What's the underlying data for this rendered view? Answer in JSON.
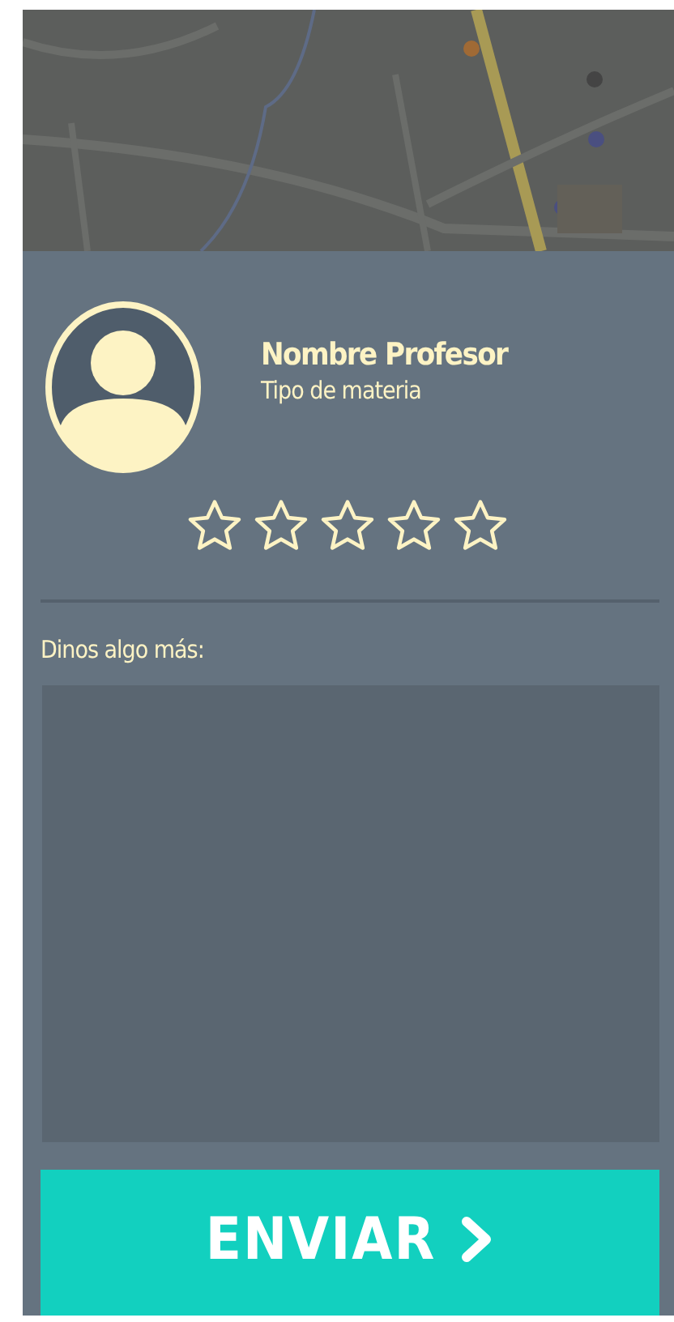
{
  "profile": {
    "name": "Nombre Profesor",
    "subject": "Tipo de materia"
  },
  "rating": {
    "stars": 0
  },
  "comment": {
    "label": "Dinos algo más:"
  },
  "submit": {
    "label": "ENVIAR"
  }
}
